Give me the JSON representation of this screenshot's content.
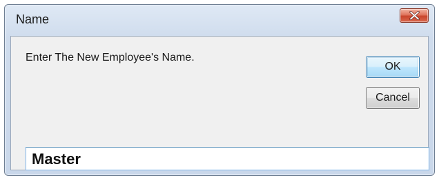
{
  "window": {
    "title": "Name",
    "close_icon": "close-icon"
  },
  "dialog": {
    "prompt": "Enter The New Employee's Name.",
    "ok_label": "OK",
    "cancel_label": "Cancel",
    "name_value": "Master"
  },
  "colors": {
    "titlebar": "#cfdced",
    "client_background": "#f0f0f0",
    "close_button": "#d8684e",
    "default_button_border": "#3c7fb1",
    "input_border": "#7eb4ea"
  }
}
